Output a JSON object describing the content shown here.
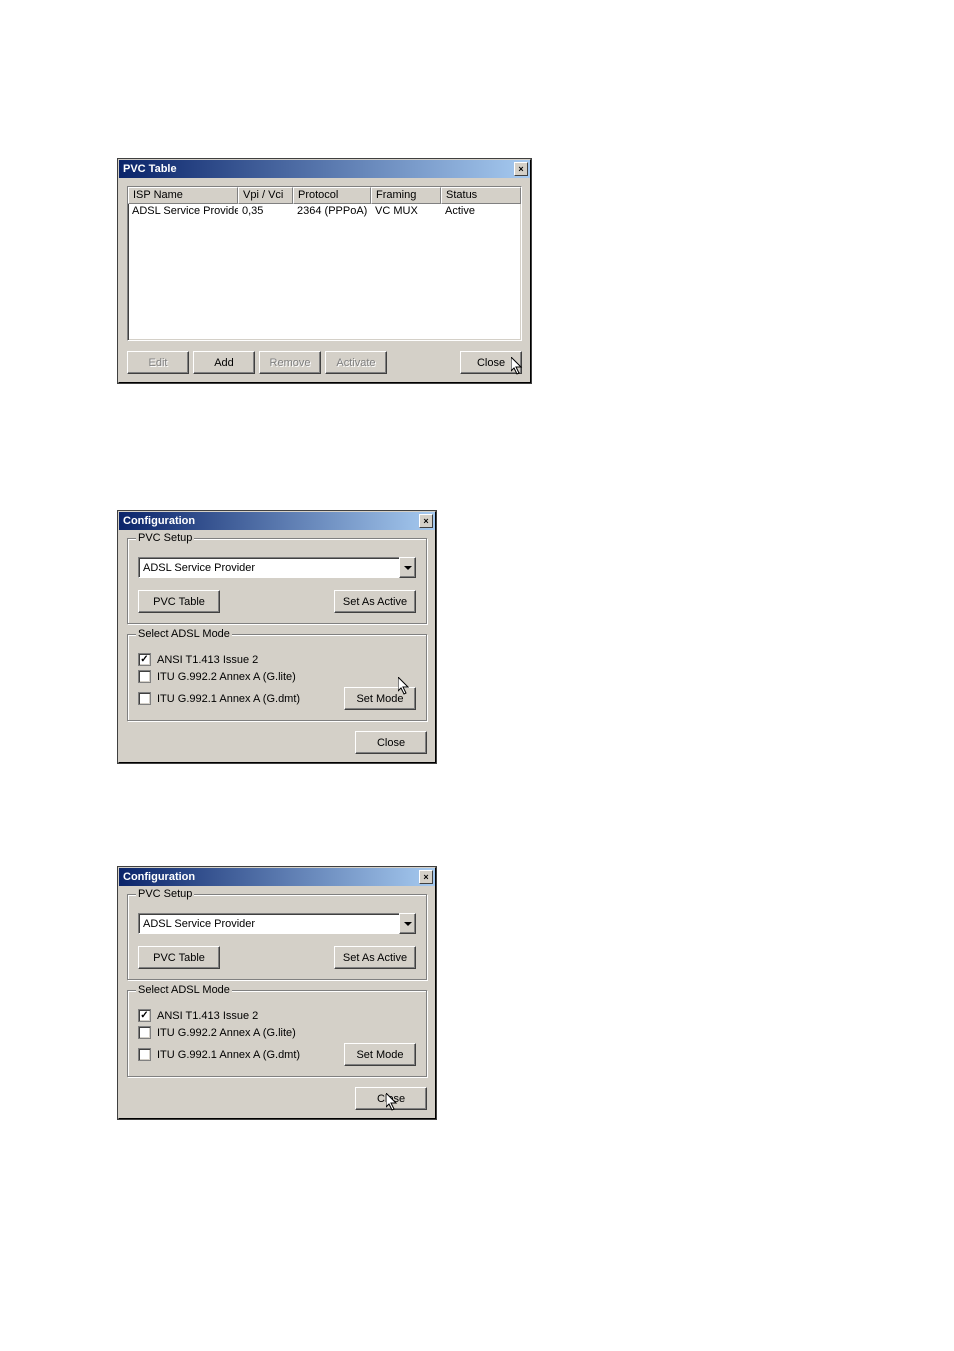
{
  "pvc_table": {
    "title": "PVC Table",
    "columns": {
      "isp": "ISP Name",
      "vpivci": "Vpi / Vci",
      "protocol": "Protocol",
      "framing": "Framing",
      "status": "Status"
    },
    "row": {
      "isp": "ADSL Service Provider",
      "vpivci": "0,35",
      "protocol": "2364 (PPPoA)",
      "framing": "VC MUX",
      "status": "Active"
    },
    "buttons": {
      "edit": "Edit",
      "add": "Add",
      "remove": "Remove",
      "activate": "Activate",
      "close": "Close"
    }
  },
  "config1": {
    "title": "Configuration",
    "pvc_setup": {
      "legend": "PVC Setup",
      "provider": "ADSL Service Provider",
      "pvc_table_btn": "PVC Table",
      "set_active_btn": "Set As Active"
    },
    "adsl_mode": {
      "legend": "Select ADSL Mode",
      "opt1": "ANSI T1.413 Issue 2",
      "opt2": "ITU G.992.2 Annex A (G.lite)",
      "opt3": "ITU G.992.1 Annex A (G.dmt)",
      "set_mode_btn": "Set Mode"
    },
    "close_btn": "Close"
  },
  "config2": {
    "title": "Configuration",
    "pvc_setup": {
      "legend": "PVC Setup",
      "provider": "ADSL Service Provider",
      "pvc_table_btn": "PVC Table",
      "set_active_btn": "Set As Active"
    },
    "adsl_mode": {
      "legend": "Select ADSL Mode",
      "opt1": "ANSI T1.413 Issue 2",
      "opt2": "ITU G.992.2 Annex A (G.lite)",
      "opt3": "ITU G.992.1 Annex A (G.dmt)",
      "set_mode_btn": "Set Mode"
    },
    "close_btn": "Close"
  }
}
